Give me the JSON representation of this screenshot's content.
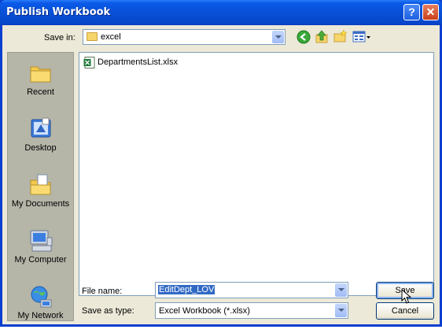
{
  "window": {
    "title": "Publish Workbook"
  },
  "title_buttons": {
    "help": "?",
    "close": "✕"
  },
  "toolbar": {
    "save_in_label": "Save in:",
    "save_in_value": "excel"
  },
  "places": [
    {
      "label": "Recent",
      "icon": "recent-icon"
    },
    {
      "label": "Desktop",
      "icon": "desktop-icon"
    },
    {
      "label": "My Documents",
      "icon": "my-documents-icon"
    },
    {
      "label": "My Computer",
      "icon": "my-computer-icon"
    },
    {
      "label": "My Network",
      "icon": "my-network-icon"
    }
  ],
  "files": [
    {
      "name": "DepartmentsList.xlsx",
      "icon": "excel-file-icon"
    }
  ],
  "form": {
    "file_name_label": "File name:",
    "file_name_value": "EditDept_LOV",
    "save_as_type_label": "Save as type:",
    "save_as_type_value": "Excel Workbook (*.xlsx)"
  },
  "buttons": {
    "save": "Save",
    "cancel": "Cancel"
  },
  "colors": {
    "title_bar": "#0850d6",
    "dialog_bg": "#ece9d8",
    "places_bg": "#b5b5a8",
    "selection": "#316ac5"
  }
}
